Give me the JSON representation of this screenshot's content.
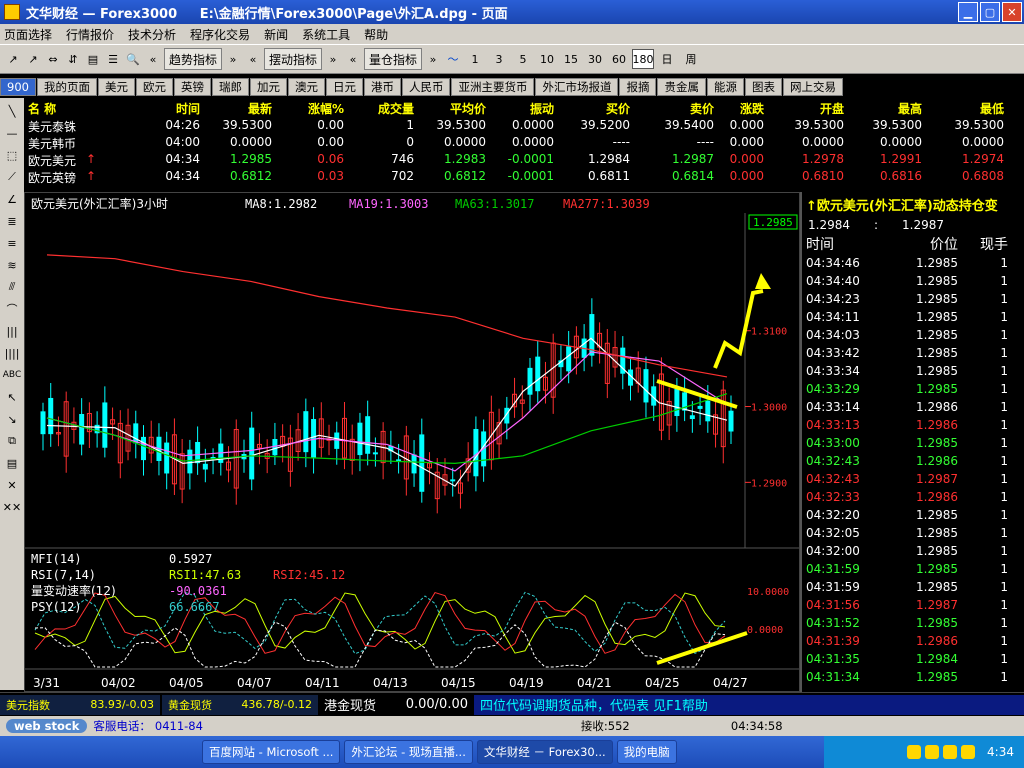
{
  "window": {
    "title": "文华财经 — Forex3000     E:\\金融行情\\Forex3000\\Page\\外汇A.dpg - 页面",
    "min": "▁",
    "max": "▢",
    "close": "✕"
  },
  "menu": [
    "页面选择",
    "行情报价",
    "技术分析",
    "程序化交易",
    "新闻",
    "系统工具",
    "帮助"
  ],
  "toolbar": {
    "trend_label": "趋势指标",
    "swing_label": "摆动指标",
    "volume_label": "量仓指标",
    "periods": [
      "1",
      "3",
      "5",
      "10",
      "15",
      "30",
      "60",
      "180",
      "日",
      "周"
    ],
    "selected_period": "180"
  },
  "tabs": [
    "900",
    "我的页面",
    "美元",
    "欧元",
    "英镑",
    "瑞郎",
    "加元",
    "澳元",
    "日元",
    "港币",
    "人民币",
    "亚洲主要货币",
    "外汇市场报道",
    "报摘",
    "贵金属",
    "能源",
    "图表",
    "网上交易"
  ],
  "quotes": {
    "headers": [
      "名 称",
      "时间",
      "最新",
      "涨幅%",
      "成交量",
      "平均价",
      "振动",
      "买价",
      "卖价",
      "涨跌",
      "开盘",
      "最高",
      "最低"
    ],
    "rows": [
      {
        "name": "美元泰铢",
        "arrow": "",
        "time": "04:26",
        "last": "39.5300",
        "chg": "0.00",
        "vol": "1",
        "avg": "39.5300",
        "swing": "0.0000",
        "bid": "39.5200",
        "ask": "39.5400",
        "diff": "0.000",
        "open": "39.5300",
        "high": "39.5300",
        "low": "39.5300",
        "color": "#ffffff"
      },
      {
        "name": "美元韩币",
        "arrow": "",
        "time": "04:00",
        "last": "0.0000",
        "chg": "0.00",
        "vol": "0",
        "avg": "0.0000",
        "swing": "0.0000",
        "bid": "----",
        "ask": "----",
        "diff": "0.000",
        "open": "0.0000",
        "high": "0.0000",
        "low": "0.0000",
        "color": "#ffffff"
      },
      {
        "name": "欧元美元",
        "arrow": "↑",
        "time": "04:34",
        "last": "1.2985",
        "chg": "0.06",
        "vol": "746",
        "avg": "1.2983",
        "swing": "-0.0001",
        "bid": "1.2984",
        "ask": "1.2987",
        "diff": "0.000",
        "open": "1.2978",
        "high": "1.2991",
        "low": "1.2974",
        "color": "#ff3030"
      },
      {
        "name": "欧元英镑",
        "arrow": "↑",
        "time": "04:34",
        "last": "0.6812",
        "chg": "0.03",
        "vol": "702",
        "avg": "0.6812",
        "swing": "-0.0001",
        "bid": "0.6811",
        "ask": "0.6814",
        "diff": "0.000",
        "open": "0.6810",
        "high": "0.6816",
        "low": "0.6808",
        "color": "#ff3030"
      }
    ]
  },
  "chart": {
    "title": "欧元美元(外汇汇率)3小时",
    "ma8": "MA8:1.2982",
    "ma19": "MA19:1.3003",
    "ma63": "MA63:1.3017",
    "ma277": "MA277:1.3039",
    "last_price": "1.2985",
    "mfi": "MFI(14)",
    "mfi_val": "0.5927",
    "rsi": "RSI(7,14)",
    "rsi1": "RSI1:47.63",
    "rsi2": "RSI2:45.12",
    "vroc": "量变动速率(12)",
    "vroc_val": "-90.0361",
    "psy": "PSY(12)",
    "psy_val": "66.6667"
  },
  "chart_data": {
    "type": "line",
    "title": "欧元美元(外汇汇率)3小时",
    "y_ticks": [
      "1.3100",
      "1.3000",
      "1.2900"
    ],
    "sub_ticks": [
      "10.0000",
      "0.0000"
    ],
    "x": [
      "3/31",
      "04/02",
      "04/05",
      "04/07",
      "04/11",
      "04/13",
      "04/15",
      "04/19",
      "04/21",
      "04/25",
      "04/27"
    ],
    "series": [
      {
        "name": "MA8",
        "values": [
          1.2975,
          1.2972,
          1.2925,
          1.2935,
          1.2962,
          1.2945,
          1.2895,
          1.302,
          1.309,
          1.3005,
          1.2982
        ]
      },
      {
        "name": "MA19",
        "values": [
          1.2985,
          1.2962,
          1.2935,
          1.2942,
          1.2958,
          1.295,
          1.2915,
          1.2985,
          1.3072,
          1.306,
          1.3003
        ]
      },
      {
        "name": "MA63",
        "values": [
          1.2985,
          1.2962,
          1.2928,
          1.2935,
          1.2932,
          1.2928,
          1.2925,
          1.2935,
          1.2968,
          1.2988,
          1.3017
        ]
      },
      {
        "name": "MA277",
        "values": [
          1.32,
          1.3195,
          1.3178,
          1.3165,
          1.3145,
          1.313,
          1.3118,
          1.309,
          1.3075,
          1.3055,
          1.3039
        ]
      }
    ],
    "ylim": [
      1.282,
      1.325
    ]
  },
  "ticker": {
    "title": "↑欧元美元(外汇汇率)动态持仓变",
    "bid": "1.2984",
    "sep": ":",
    "ask": "1.2987",
    "cols": [
      "时间",
      "价位",
      "现手"
    ],
    "rows": [
      {
        "t": "04:34:46",
        "p": "1.2985",
        "v": "1",
        "c": "#ffffff"
      },
      {
        "t": "04:34:40",
        "p": "1.2985",
        "v": "1",
        "c": "#ffffff"
      },
      {
        "t": "04:34:23",
        "p": "1.2985",
        "v": "1",
        "c": "#ffffff"
      },
      {
        "t": "04:34:11",
        "p": "1.2985",
        "v": "1",
        "c": "#ffffff"
      },
      {
        "t": "04:34:03",
        "p": "1.2985",
        "v": "1",
        "c": "#ffffff"
      },
      {
        "t": "04:33:42",
        "p": "1.2985",
        "v": "1",
        "c": "#ffffff"
      },
      {
        "t": "04:33:34",
        "p": "1.2985",
        "v": "1",
        "c": "#ffffff"
      },
      {
        "t": "04:33:29",
        "p": "1.2985",
        "v": "1",
        "c": "#33ff33"
      },
      {
        "t": "04:33:14",
        "p": "1.2986",
        "v": "1",
        "c": "#ffffff"
      },
      {
        "t": "04:33:13",
        "p": "1.2986",
        "v": "1",
        "c": "#ff3030"
      },
      {
        "t": "04:33:00",
        "p": "1.2985",
        "v": "1",
        "c": "#33ff33"
      },
      {
        "t": "04:32:43",
        "p": "1.2986",
        "v": "1",
        "c": "#33ff33"
      },
      {
        "t": "04:32:43",
        "p": "1.2987",
        "v": "1",
        "c": "#ff3030"
      },
      {
        "t": "04:32:33",
        "p": "1.2986",
        "v": "1",
        "c": "#ff3030"
      },
      {
        "t": "04:32:20",
        "p": "1.2985",
        "v": "1",
        "c": "#ffffff"
      },
      {
        "t": "04:32:05",
        "p": "1.2985",
        "v": "1",
        "c": "#ffffff"
      },
      {
        "t": "04:32:00",
        "p": "1.2985",
        "v": "1",
        "c": "#ffffff"
      },
      {
        "t": "04:31:59",
        "p": "1.2985",
        "v": "1",
        "c": "#33ff33"
      },
      {
        "t": "04:31:59",
        "p": "1.2985",
        "v": "1",
        "c": "#ffffff"
      },
      {
        "t": "04:31:56",
        "p": "1.2987",
        "v": "1",
        "c": "#ff3030"
      },
      {
        "t": "04:31:52",
        "p": "1.2985",
        "v": "1",
        "c": "#33ff33"
      },
      {
        "t": "04:31:39",
        "p": "1.2986",
        "v": "1",
        "c": "#ff3030"
      },
      {
        "t": "04:31:35",
        "p": "1.2984",
        "v": "1",
        "c": "#33ff33"
      },
      {
        "t": "04:31:34",
        "p": "1.2985",
        "v": "1",
        "c": "#33ff33"
      }
    ]
  },
  "status": {
    "usd_index": "美元指数",
    "usd_val": "83.93/-0.03",
    "gold": "黄金现货",
    "gold_val": "436.78/-0.12",
    "hk_gold": "港金现货",
    "hk_val": "0.00/0.00",
    "tip": "四位代码调期货品种，代码表 见F1帮助"
  },
  "bottom": {
    "brand": "web stock",
    "service": "客服电话：",
    "phone": "0411-84",
    "recv": "接收:552",
    "time": "04:34:58"
  },
  "taskbar": {
    "items": [
      "百度网站 - Microsoft ...",
      "外汇论坛 - 现场直播...",
      "文华财经 － Forex30...",
      "我的电脑"
    ],
    "clock": "4:34"
  },
  "colors": {
    "up": "#ff3030",
    "down": "#00ffff",
    "ma8": "#ffffff",
    "ma19": "#ff66ff",
    "ma63": "#00cc00",
    "ma277": "#ff3030",
    "annotation": "#ffff00"
  }
}
